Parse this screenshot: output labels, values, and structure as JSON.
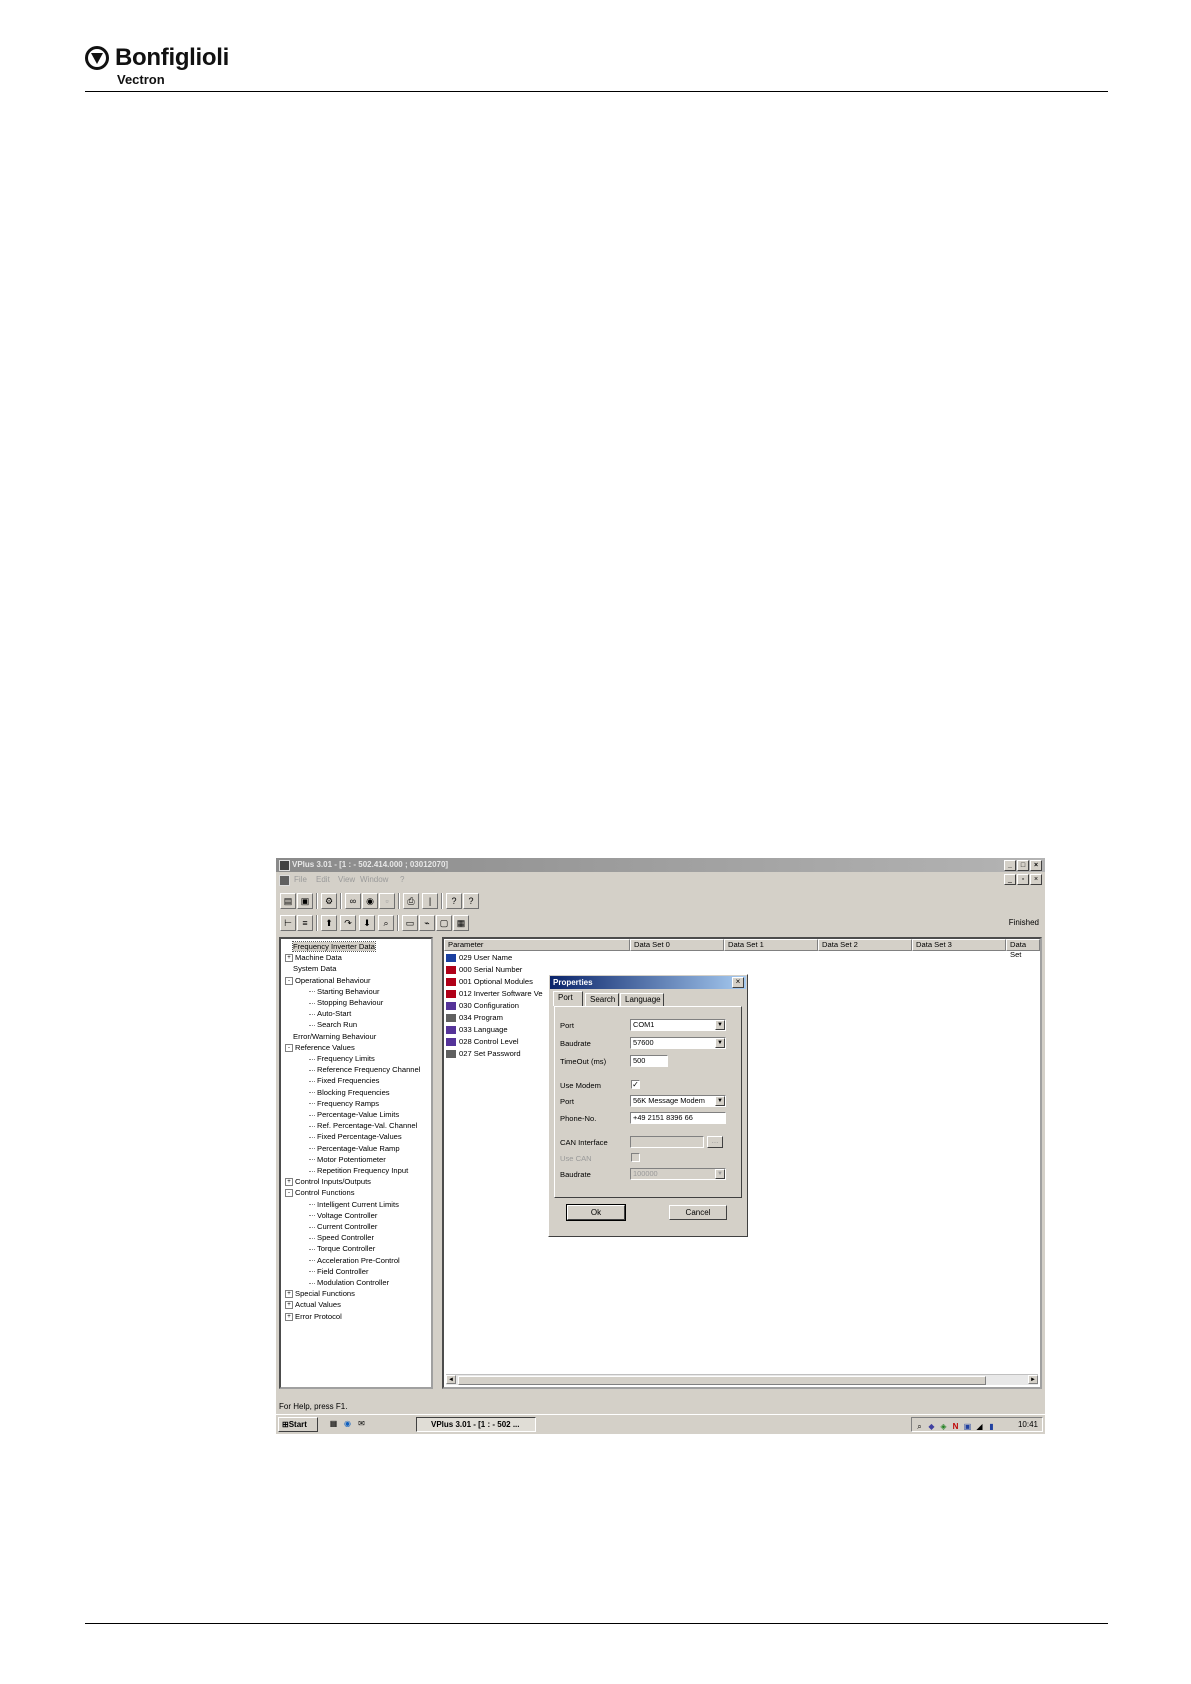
{
  "page": {
    "logo": {
      "brand": "Bonfiglioli",
      "sub": "Vectron"
    }
  },
  "app": {
    "title": "VPlus 3.01 - [1 : - 502.414.000 ; 03012070]",
    "menu": [
      "File",
      "Edit",
      "View",
      "Window",
      "?"
    ],
    "status_right": "Finished",
    "status_help": "For Help, press F1."
  },
  "tree": [
    {
      "label": "Frequency Inverter Data",
      "level": 0,
      "expander": "",
      "selected": true
    },
    {
      "label": "Machine Data",
      "level": 0,
      "expander": "+"
    },
    {
      "label": "System Data",
      "level": 0,
      "expander": ""
    },
    {
      "label": "Operational Behaviour",
      "level": 0,
      "expander": "-"
    },
    {
      "label": "Starting Behaviour",
      "level": 1
    },
    {
      "label": "Stopping Behaviour",
      "level": 1
    },
    {
      "label": "Auto-Start",
      "level": 1
    },
    {
      "label": "Search Run",
      "level": 1
    },
    {
      "label": "Error/Warning Behaviour",
      "level": 0,
      "expander": ""
    },
    {
      "label": "Reference Values",
      "level": 0,
      "expander": "-"
    },
    {
      "label": "Frequency Limits",
      "level": 1
    },
    {
      "label": "Reference Frequency Channel",
      "level": 1
    },
    {
      "label": "Fixed Frequencies",
      "level": 1
    },
    {
      "label": "Blocking Frequencies",
      "level": 1
    },
    {
      "label": "Frequency Ramps",
      "level": 1
    },
    {
      "label": "Percentage-Value Limits",
      "level": 1
    },
    {
      "label": "Ref. Percentage-Val. Channel",
      "level": 1
    },
    {
      "label": "Fixed Percentage-Values",
      "level": 1
    },
    {
      "label": "Percentage-Value Ramp",
      "level": 1
    },
    {
      "label": "Motor Potentiometer",
      "level": 1
    },
    {
      "label": "Repetition Frequency Input",
      "level": 1
    },
    {
      "label": "Control Inputs/Outputs",
      "level": 0,
      "expander": "+"
    },
    {
      "label": "Control Functions",
      "level": 0,
      "expander": "-"
    },
    {
      "label": "Intelligent Current Limits",
      "level": 1
    },
    {
      "label": "Voltage Controller",
      "level": 1
    },
    {
      "label": "Current Controller",
      "level": 1
    },
    {
      "label": "Speed Controller",
      "level": 1
    },
    {
      "label": "Torque Controller",
      "level": 1
    },
    {
      "label": "Acceleration Pre-Control",
      "level": 1
    },
    {
      "label": "Field Controller",
      "level": 1
    },
    {
      "label": "Modulation Controller",
      "level": 1
    },
    {
      "label": "Special Functions",
      "level": 0,
      "expander": "+"
    },
    {
      "label": "Actual Values",
      "level": 0,
      "expander": "+"
    },
    {
      "label": "Error Protocol",
      "level": 0,
      "expander": "+"
    }
  ],
  "list": {
    "columns": [
      "Parameter",
      "Data Set 0",
      "Data Set 1",
      "Data Set 2",
      "Data Set 3",
      "Data Set"
    ],
    "rows": [
      {
        "num": "029",
        "name": "User Name",
        "icon": "blue"
      },
      {
        "num": "000",
        "name": "Serial Number",
        "icon": "red"
      },
      {
        "num": "001",
        "name": "Optional Modules",
        "icon": "red"
      },
      {
        "num": "012",
        "name": "Inverter Software Ve",
        "icon": "red"
      },
      {
        "num": "030",
        "name": "Configuration",
        "icon": "edit"
      },
      {
        "num": "034",
        "name": "Program",
        "icon": "key"
      },
      {
        "num": "033",
        "name": "Language",
        "icon": "edit"
      },
      {
        "num": "028",
        "name": "Control Level",
        "icon": "edit"
      },
      {
        "num": "027",
        "name": "Set Password",
        "icon": "key"
      }
    ]
  },
  "dialog": {
    "title": "Properties",
    "tabs": [
      "Port",
      "Search",
      "Language"
    ],
    "port_label": "Port",
    "port_value": "COM1",
    "baudrate_label": "Baudrate",
    "baudrate_value": "57600",
    "timeout_label": "TimeOut (ms)",
    "timeout_value": "500",
    "use_modem_label": "Use Modem",
    "use_modem_checked": true,
    "modem_port_label": "Port",
    "modem_port_value": "56K Message Modem",
    "phone_label": "Phone-No.",
    "phone_value": "+49 2151 8396 66",
    "can_interface_label": "CAN Interface",
    "can_interface_value": "",
    "use_can_label": "Use CAN",
    "can_baud_label": "Baudrate",
    "can_baud_value": "100000",
    "ok_label": "Ok",
    "cancel_label": "Cancel",
    "browse_label": "..."
  },
  "taskbar": {
    "start": "Start",
    "task": "VPlus 3.01 - [1 : - 502 ...",
    "clock": "10:41"
  },
  "colors": {
    "title_active": "#0a246a",
    "title_inactive": "#8a8a8a",
    "face": "#d4d0c8"
  }
}
